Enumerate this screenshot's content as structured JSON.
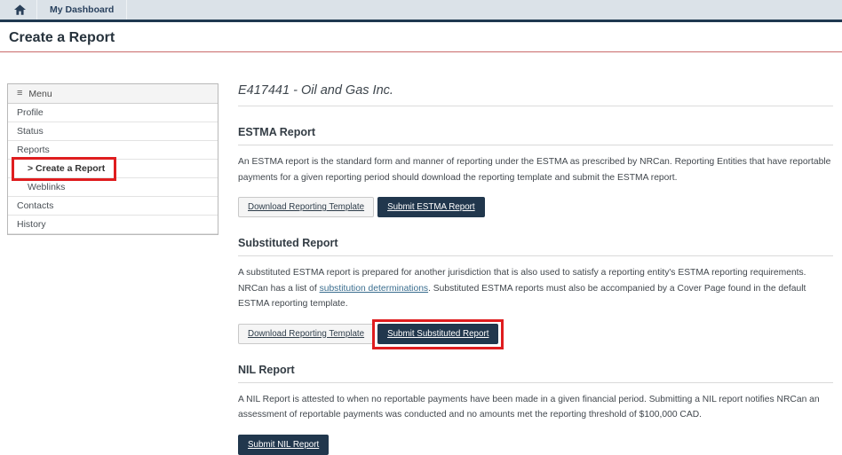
{
  "navbar": {
    "home_icon": "home-icon",
    "dashboard_label": "My Dashboard"
  },
  "page": {
    "title": "Create a Report"
  },
  "sidebar": {
    "header": "Menu",
    "menu_icon": "menu-icon",
    "items": [
      {
        "label": "Profile"
      },
      {
        "label": "Status"
      },
      {
        "label": "Reports"
      },
      {
        "label": "> Create a Report"
      },
      {
        "label": "Weblinks"
      },
      {
        "label": "Contacts"
      },
      {
        "label": "History"
      }
    ]
  },
  "main": {
    "entity_heading": "E417441 - Oil and Gas Inc.",
    "sections": [
      {
        "title": "ESTMA Report",
        "description": "An ESTMA report is the standard form and manner of reporting under the ESTMA as prescribed by NRCan. Reporting Entities that have reportable payments for a given reporting period should download the reporting template and submit the ESTMA report.",
        "buttons": [
          {
            "label": "Download Reporting Template"
          },
          {
            "label": "Submit ESTMA Report"
          }
        ]
      },
      {
        "title": "Substituted Report",
        "description_before_link": "A substituted ESTMA report is prepared for another jurisdiction that is also used to satisfy a reporting entity's ESTMA reporting requirements. NRCan has a list of ",
        "link_text": "substitution determinations",
        "description_after_link": ". Substituted ESTMA reports must also be accompanied by a Cover Page found in the default ESTMA reporting template.",
        "buttons": [
          {
            "label": "Download Reporting Template"
          },
          {
            "label": "Submit Substituted Report"
          }
        ]
      },
      {
        "title": "NIL Report",
        "description": "A NIL Report is attested to when no reportable payments have been made in a given financial period. Submitting a NIL report notifies NRCan an assessment of reportable payments was conducted and no amounts met the reporting threshold of $100,000 CAD.",
        "buttons": [
          {
            "label": "Submit NIL Report"
          }
        ]
      }
    ]
  },
  "annotations": {
    "highlight_color": "#df1d1f",
    "highlighted_elements": [
      "sidebar-item-create-a-report",
      "submit-substituted-report-button"
    ]
  },
  "colors": {
    "navbar_bg": "#dbe2e8",
    "navbar_strip": "#1f3850",
    "dark_button": "#21374d",
    "title_rule": "#c96a6a",
    "link": "#3b6e8f"
  }
}
